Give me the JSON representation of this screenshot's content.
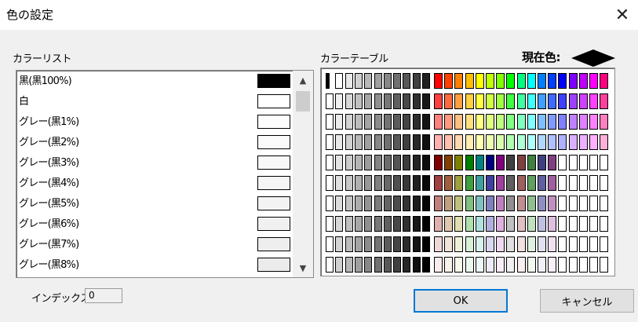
{
  "window": {
    "title": "色の設定",
    "close_icon": "close-icon"
  },
  "labels": {
    "color_list": "カラーリスト",
    "color_table": "カラーテーブル",
    "current_color": "現在色:",
    "index": "インデックス:"
  },
  "index_value": "0",
  "buttons": {
    "ok": "OK",
    "cancel": "キャンセル"
  },
  "color_list": [
    {
      "name": "黒(黒100%)",
      "color": "#000000"
    },
    {
      "name": "白",
      "color": "#ffffff"
    },
    {
      "name": "グレー(黒1%)",
      "color": "#fdfdfd"
    },
    {
      "name": "グレー(黒2%)",
      "color": "#fafafa"
    },
    {
      "name": "グレー(黒3%)",
      "color": "#f8f8f8"
    },
    {
      "name": "グレー(黒4%)",
      "color": "#f5f5f5"
    },
    {
      "name": "グレー(黒5%)",
      "color": "#f3f3f3"
    },
    {
      "name": "グレー(黒6%)",
      "color": "#f0f0f0"
    },
    {
      "name": "グレー(黒7%)",
      "color": "#eeeeee"
    },
    {
      "name": "グレー(黒8%)",
      "color": "#ebebeb"
    }
  ],
  "color_table": {
    "grays": [
      [
        "#000000",
        "#ffffff",
        "#e8e8e8",
        "#d0d0d0",
        "#b8b8b8",
        "#a0a0a0",
        "#888888",
        "#707070",
        "#585858",
        "#404040",
        "#202020"
      ],
      [
        "#ffffff",
        "#f0f0f0",
        "#d8d8d8",
        "#c0c0c0",
        "#a8a8a8",
        "#909090",
        "#787878",
        "#606060",
        "#484848",
        "#303030",
        "#181818"
      ],
      [
        "#ffffff",
        "#ececec",
        "#d4d4d4",
        "#bcbcbc",
        "#a4a4a4",
        "#8c8c8c",
        "#747474",
        "#5c5c5c",
        "#444444",
        "#2c2c2c",
        "#141414"
      ],
      [
        "#ffffff",
        "#e8e8e8",
        "#d0d0d0",
        "#b8b8b8",
        "#a0a0a0",
        "#888888",
        "#707070",
        "#585858",
        "#404040",
        "#282828",
        "#101010"
      ],
      [
        "#ffffff",
        "#e4e4e4",
        "#cccccc",
        "#b4b4b4",
        "#9c9c9c",
        "#848484",
        "#6c6c6c",
        "#545454",
        "#3c3c3c",
        "#242424",
        "#0c0c0c"
      ],
      [
        "#ffffff",
        "#e0e0e0",
        "#c8c8c8",
        "#b0b0b0",
        "#989898",
        "#808080",
        "#686868",
        "#505050",
        "#383838",
        "#202020",
        "#080808"
      ],
      [
        "#ffffff",
        "#dcdcdc",
        "#c4c4c4",
        "#acacac",
        "#949494",
        "#7c7c7c",
        "#646464",
        "#4c4c4c",
        "#343434",
        "#1c1c1c",
        "#040404"
      ],
      [
        "#ffffff",
        "#d8d8d8",
        "#c0c0c0",
        "#a8a8a8",
        "#909090",
        "#787878",
        "#606060",
        "#484848",
        "#303030",
        "#181818",
        "#000000"
      ],
      [
        "#ffffff",
        "#d4d4d4",
        "#bcbcbc",
        "#a4a4a4",
        "#8c8c8c",
        "#747474",
        "#5c5c5c",
        "#444444",
        "#2c2c2c",
        "#141414",
        "#000000"
      ],
      [
        "#ffffff",
        "#d0d0d0",
        "#b8b8b8",
        "#a0a0a0",
        "#888888",
        "#707070",
        "#585858",
        "#404040",
        "#282828",
        "#101010",
        "#000000"
      ]
    ],
    "hues": [
      [
        "#ff0000",
        "#ff4000",
        "#ff8000",
        "#ffbf00",
        "#ffff00",
        "#bfff00",
        "#80ff00",
        "#00ff00",
        "#00ff80",
        "#00ffff",
        "#0080ff",
        "#0040ff",
        "#0000ff",
        "#8000ff",
        "#bf00ff",
        "#ff00ff",
        "#ff0080"
      ],
      [
        "#ff4040",
        "#ff6a40",
        "#ff9f40",
        "#ffcf40",
        "#ffff40",
        "#cfff40",
        "#9fff40",
        "#40ff40",
        "#40ff9f",
        "#40ffff",
        "#409fff",
        "#406aff",
        "#4040ff",
        "#9f40ff",
        "#cf40ff",
        "#ff40ff",
        "#ff409f"
      ],
      [
        "#ff8080",
        "#ff9980",
        "#ffbf80",
        "#ffdf80",
        "#ffff80",
        "#dfff80",
        "#bfff80",
        "#80ff80",
        "#80ffbf",
        "#80ffff",
        "#80bfff",
        "#8099ff",
        "#8080ff",
        "#bf80ff",
        "#df80ff",
        "#ff80ff",
        "#ff80bf"
      ],
      [
        "#ffb0b0",
        "#ffc0b0",
        "#ffd8b0",
        "#ffecb0",
        "#ffffb0",
        "#ecffb0",
        "#d8ffb0",
        "#b0ffb0",
        "#b0ffd8",
        "#b0ffff",
        "#b0d8ff",
        "#b0c0ff",
        "#b0b0ff",
        "#d8b0ff",
        "#ecb0ff",
        "#ffb0ff",
        "#ffb0d8"
      ],
      [
        "#800000",
        "#804000",
        "#808000",
        "#008000",
        "#008080",
        "#000080",
        "#800080",
        "#404040",
        "#804040",
        "#408040",
        "#404080",
        "#804080",
        "#ffffff",
        "#ffffff",
        "#ffffff",
        "#ffffff",
        "#ffffff"
      ],
      [
        "#a04040",
        "#a06040",
        "#a0a040",
        "#40a040",
        "#40a0a0",
        "#4040a0",
        "#a040a0",
        "#606060",
        "#a06060",
        "#60a060",
        "#6060a0",
        "#a060a0",
        "#ffffff",
        "#ffffff",
        "#ffffff",
        "#ffffff",
        "#ffffff"
      ],
      [
        "#c08080",
        "#c0a080",
        "#c0c080",
        "#80c080",
        "#80c0c0",
        "#8080c0",
        "#c080c0",
        "#909090",
        "#c09090",
        "#90c090",
        "#9090c0",
        "#c090c0",
        "#ffffff",
        "#ffffff",
        "#ffffff",
        "#ffffff",
        "#ffffff"
      ],
      [
        "#e0b0b0",
        "#e0c8b0",
        "#e0e0b0",
        "#b0e0b0",
        "#b0e0e0",
        "#b0b0e0",
        "#e0b0e0",
        "#c0c0c0",
        "#e0c0c0",
        "#c0e0c0",
        "#c0c0e0",
        "#e0c0e0",
        "#ffffff",
        "#ffffff",
        "#ffffff",
        "#ffffff",
        "#ffffff"
      ],
      [
        "#f0d8d8",
        "#f0e4d8",
        "#f0f0d8",
        "#d8f0d8",
        "#d8f0f0",
        "#d8d8f0",
        "#f0d8f0",
        "#e0e0e0",
        "#f0e0e0",
        "#e0f0e0",
        "#e0e0f0",
        "#f0e0f0",
        "#ffffff",
        "#ffffff",
        "#ffffff",
        "#ffffff",
        "#ffffff"
      ],
      [
        "#f8ecec",
        "#f8f2ec",
        "#f8f8ec",
        "#ecf8ec",
        "#ecf8f8",
        "#ececf8",
        "#f8ecf8",
        "#f0f0f0",
        "#f8f0f0",
        "#f0f8f0",
        "#f0f0f8",
        "#f8f0f8",
        "#ffffff",
        "#ffffff",
        "#ffffff",
        "#ffffff",
        "#ffffff"
      ]
    ]
  },
  "current_color_value": "#000000"
}
